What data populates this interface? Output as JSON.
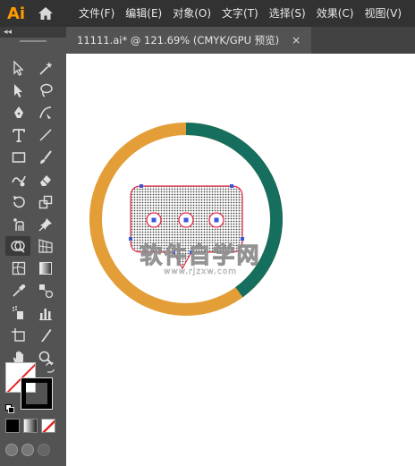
{
  "app": {
    "logo": "Ai"
  },
  "menu": [
    {
      "label": "文件(F)"
    },
    {
      "label": "编辑(E)"
    },
    {
      "label": "对象(O)"
    },
    {
      "label": "文字(T)"
    },
    {
      "label": "选择(S)"
    },
    {
      "label": "效果(C)"
    },
    {
      "label": "视图(V)"
    }
  ],
  "toolpanel": {
    "collapse_label": "◂◂"
  },
  "tab": {
    "title": "11111.ai* @ 121.69% (CMYK/GPU 预览)",
    "close": "×"
  },
  "colors": {
    "ring_green": "#166e5e",
    "ring_orange": "#e39e38",
    "selection": "#e2304a",
    "anchor": "#3a57d9"
  },
  "artwork": {
    "ring_progress_green": 0.4
  },
  "watermark": {
    "main": "软件自学网",
    "sub": "www.rjzxw.com"
  }
}
